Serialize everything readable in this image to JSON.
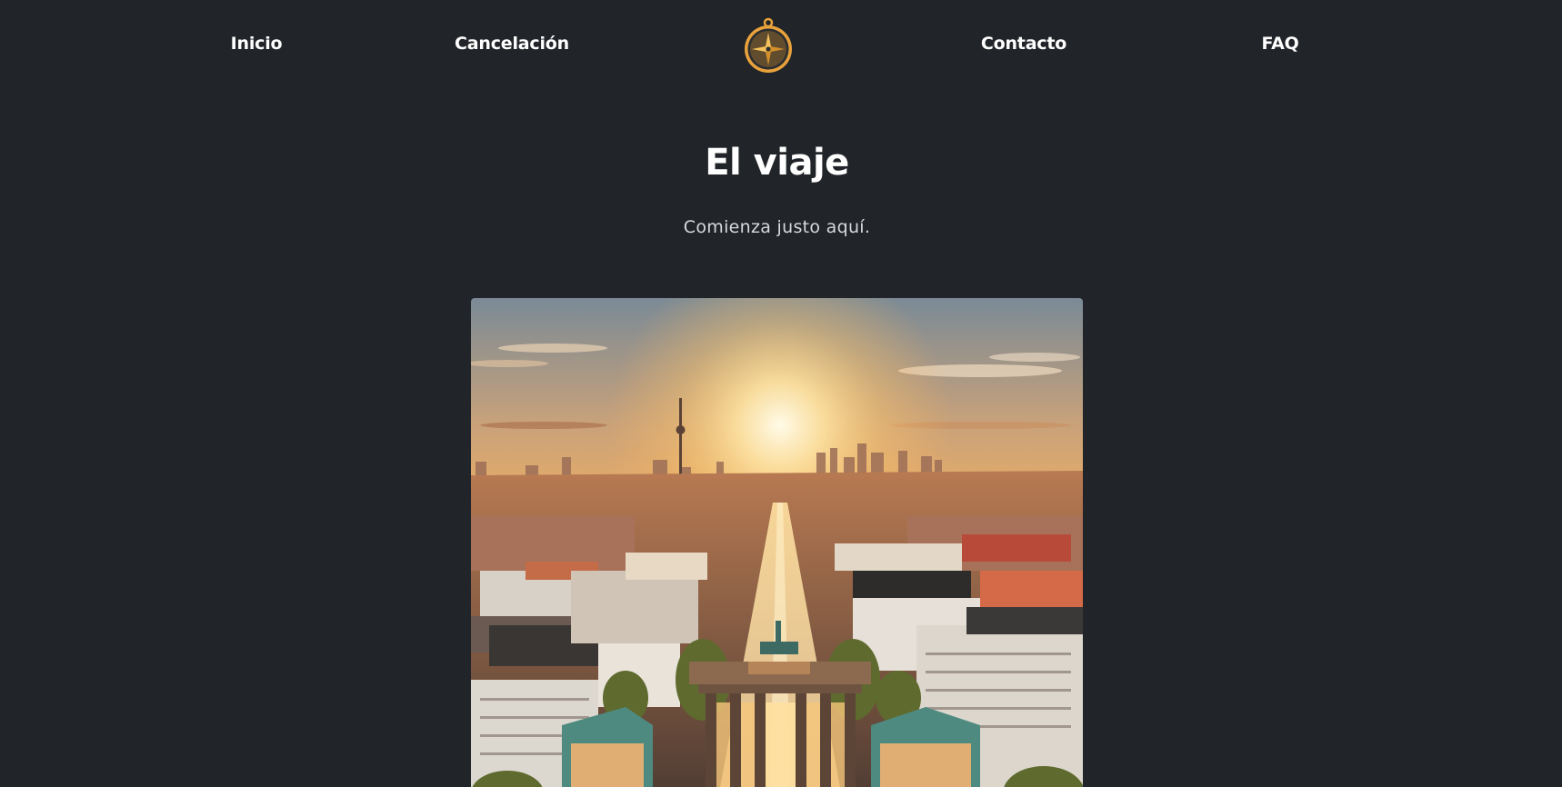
{
  "nav": {
    "items": [
      {
        "label": "Inicio"
      },
      {
        "label": "Cancelación"
      },
      {
        "label": "Contacto"
      },
      {
        "label": "FAQ"
      }
    ],
    "logo_icon": "compass-icon"
  },
  "hero": {
    "title": "El viaje",
    "subtitle": "Comienza justo aquí.",
    "image_icon": "city-sunset-image"
  },
  "colors": {
    "background": "#212428",
    "text": "#ffffff",
    "subtitle": "#d7d9dc",
    "logo_gold": "#e9a23b"
  }
}
